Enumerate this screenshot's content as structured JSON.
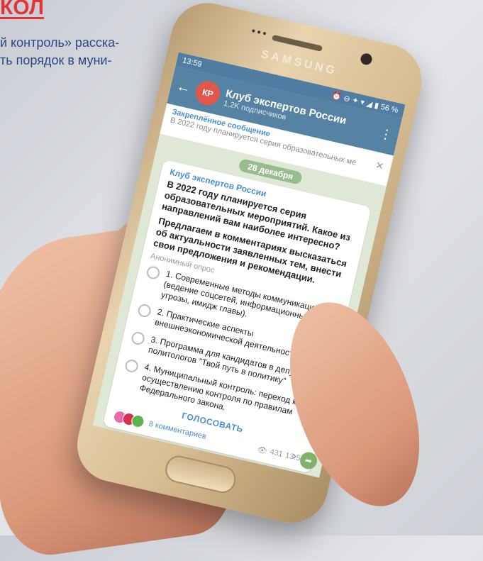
{
  "article": {
    "headline_fragment": "КОЛ",
    "lead_lines": [
      "й контроль» расска-",
      "ть порядок в муни-"
    ]
  },
  "phone": {
    "brand": "SAMSUNG",
    "status_time": "13:59",
    "status_icons": "⏰ ⊖ ✦ ▾ ◢ ▮ 56 %"
  },
  "telegram": {
    "back_icon": "arrow-left-icon",
    "channel_avatar": "КР",
    "channel_name": "Клуб экспертов России",
    "channel_subs": "1,2K подписчиков",
    "pinned_title": "Закреплённое сообщение",
    "pinned_text": "В 2022 году планируется серия образовательных ме...",
    "date_badge": "28 декабря",
    "message": {
      "author": "Клуб экспертов России",
      "question_1": "В 2022 году планируется серия образовательных мероприятий. Какое из направлений вам наиболее интересно?",
      "question_2": "Предлагаем в комментариях высказаться об актуальности заявленных тем, внести свои предложения и рекомендации.",
      "poll_type": "Анонимный опрос",
      "options": [
        "1. Современные методы коммуникации (ведение соцсетей, информационные угрозы, имидж главы).",
        "2. Практические аспекты внешнеэкономической деятельности (ВЭД)",
        "3. Программа для кандидатов в депутаты и политологов \"Твой путь в политику\"",
        "4. Муниципальный контроль: переход к осуществлению контроля по правилам Федерального закона."
      ],
      "vote_label": "ГОЛОСОВАТЬ",
      "comments_label": "8 комментариев",
      "views": "431",
      "time": "13:56"
    }
  },
  "colors": {
    "headline": "#e0343a",
    "lead_text": "#2a4a86",
    "telegram_header": "#5682a3",
    "link_blue": "#4a90d0",
    "chat_bg": "#dfe8d6"
  }
}
